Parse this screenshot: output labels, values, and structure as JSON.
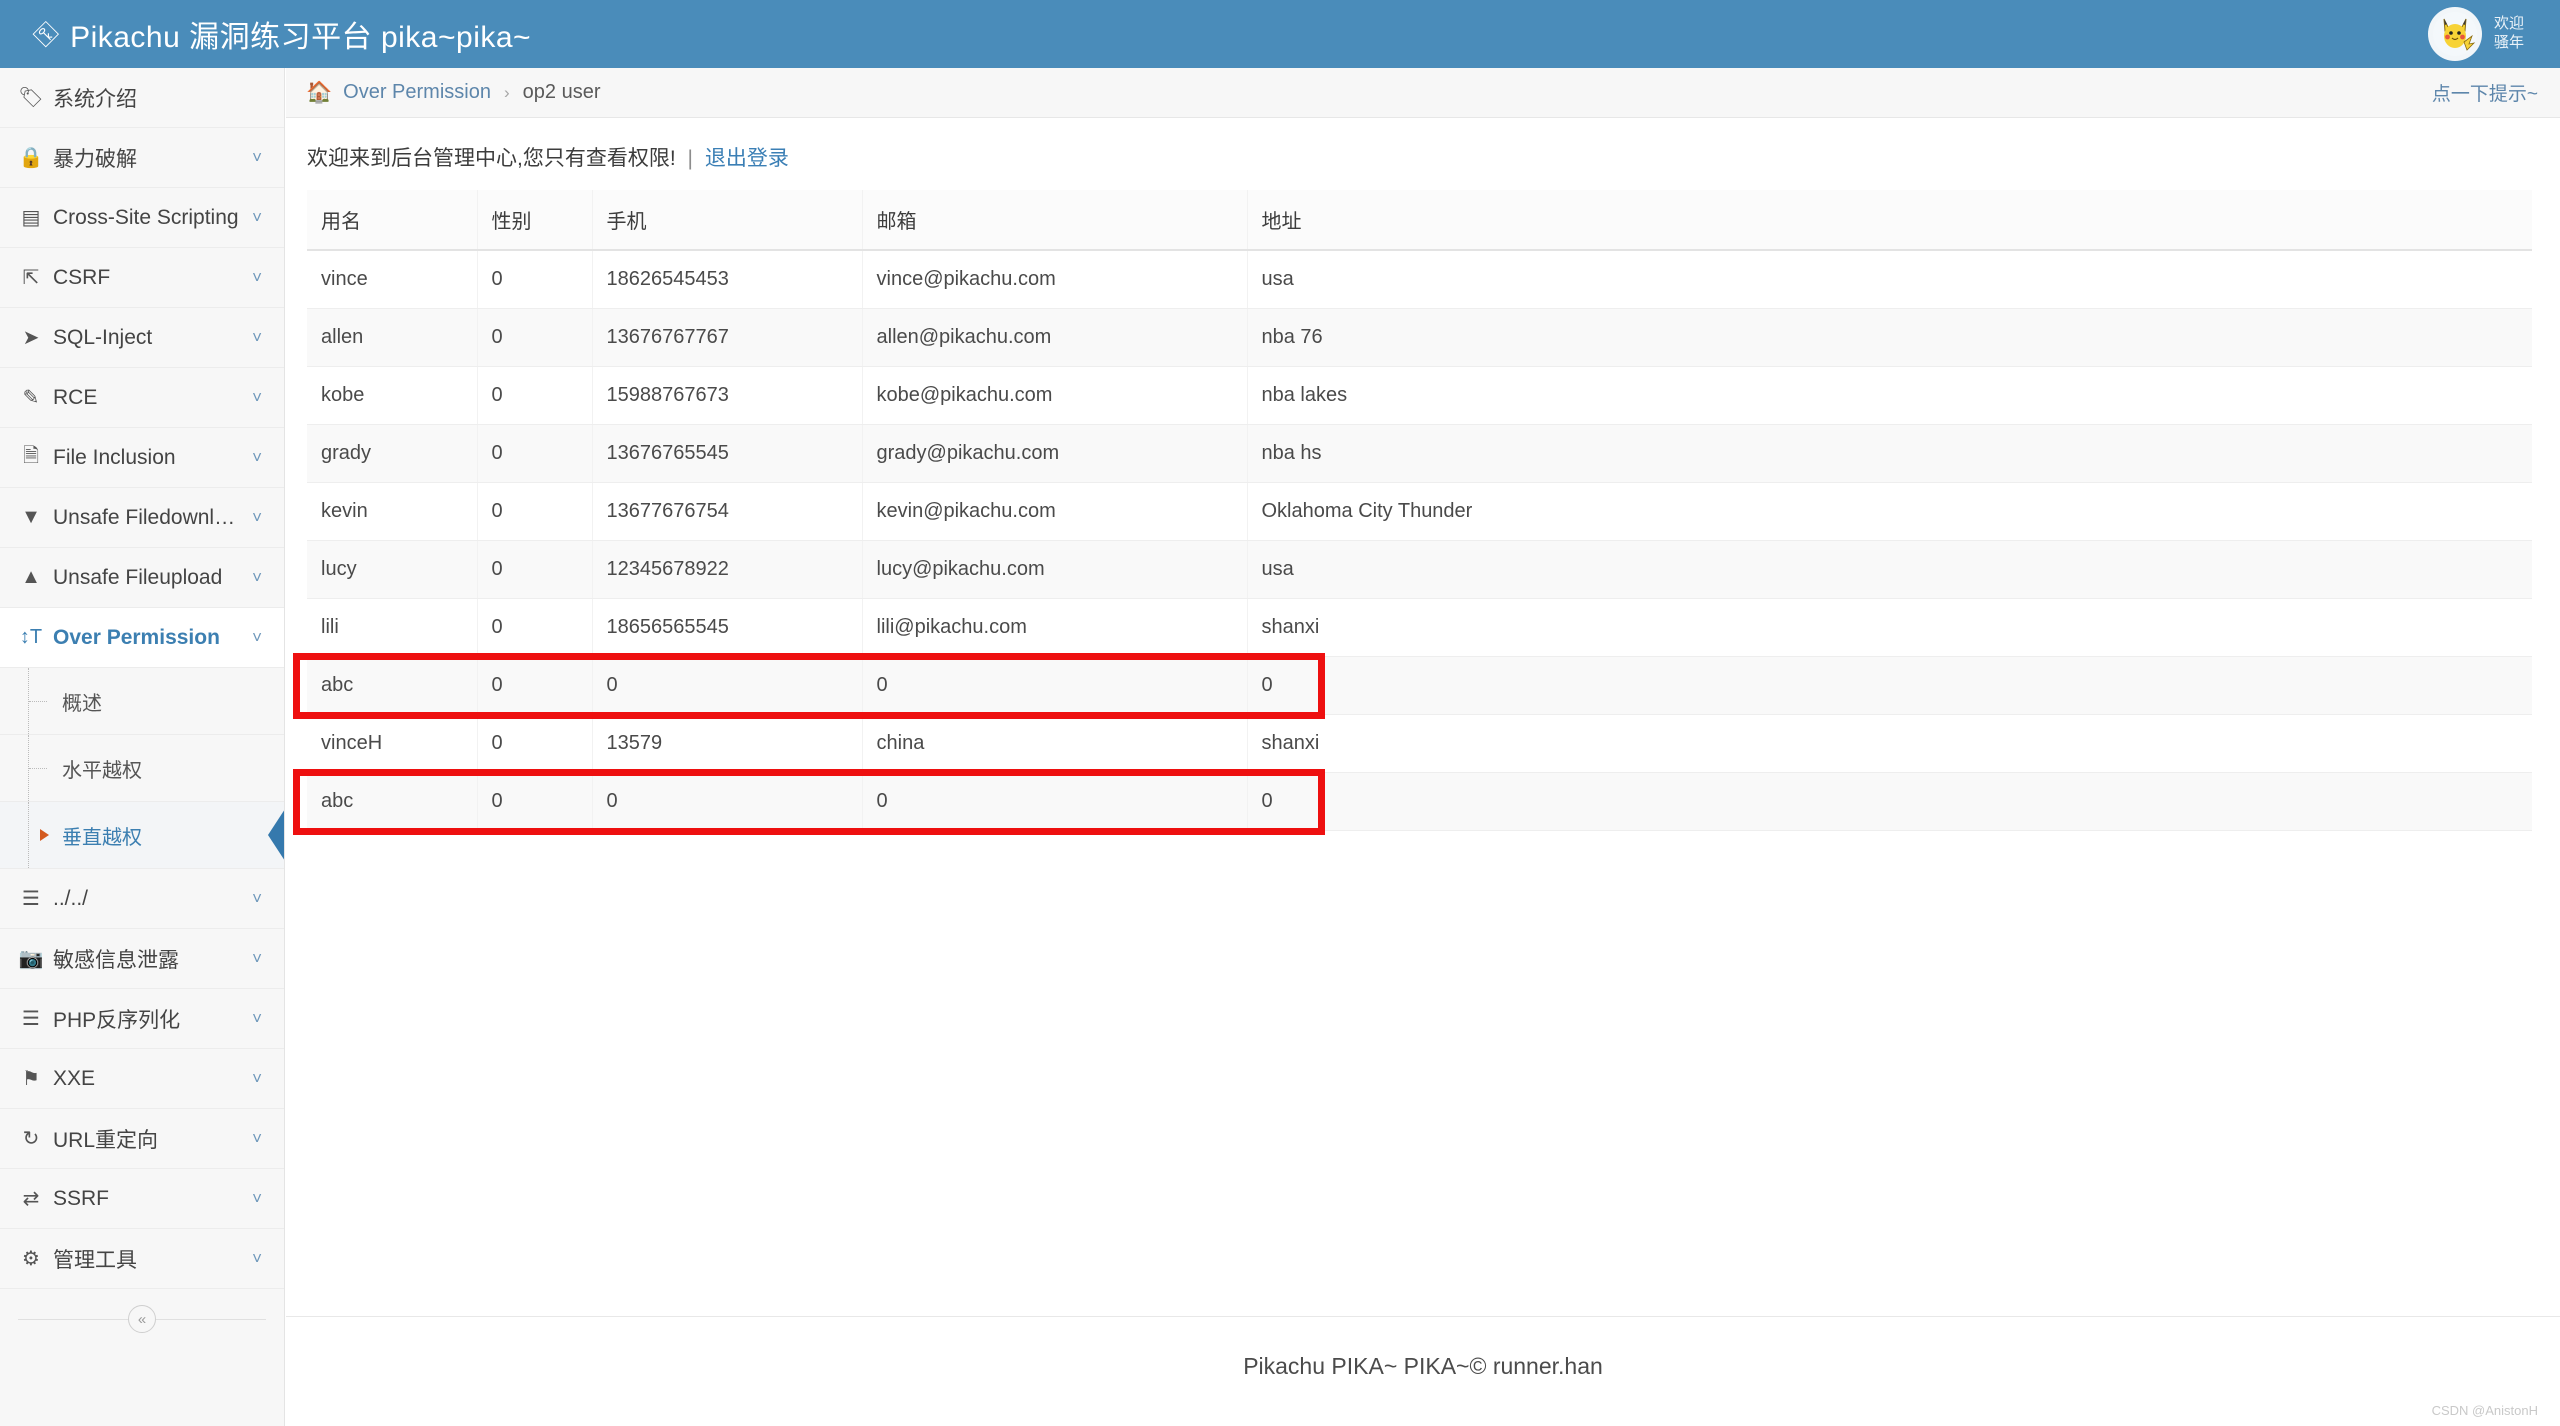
{
  "header": {
    "title": "Pikachu 漏洞练习平台 pika~pika~",
    "key_icon": "⚷",
    "welcome_line1": "欢迎",
    "welcome_line2": "骚年",
    "bg_color": "#4a8cba"
  },
  "sidebar": {
    "items": [
      {
        "label": "系统介绍",
        "icon": "tag-icon",
        "glyph": "🏷",
        "caret": false,
        "active": false
      },
      {
        "label": "暴力破解",
        "icon": "lock-icon",
        "glyph": "🔒",
        "caret": true,
        "active": false
      },
      {
        "label": "Cross-Site Scripting",
        "icon": "list-icon",
        "glyph": "☲",
        "caret": true,
        "active": false
      },
      {
        "label": "CSRF",
        "icon": "external-link-icon",
        "glyph": "↱",
        "caret": true,
        "active": false
      },
      {
        "label": "SQL-Inject",
        "icon": "plane-icon",
        "glyph": "✈",
        "caret": true,
        "active": false
      },
      {
        "label": "RCE",
        "icon": "pencil-icon",
        "glyph": "✎",
        "caret": true,
        "active": false
      },
      {
        "label": "File Inclusion",
        "icon": "file-icon",
        "glyph": "🗎",
        "caret": true,
        "active": false
      },
      {
        "label": "Unsafe Filedownload",
        "icon": "download-icon",
        "glyph": "⬇",
        "caret": true,
        "active": false
      },
      {
        "label": "Unsafe Fileupload",
        "icon": "upload-icon",
        "glyph": "⬆",
        "caret": true,
        "active": false
      },
      {
        "label": "Over Permission",
        "icon": "text-height-icon",
        "glyph": "T",
        "caret": true,
        "active": true
      }
    ],
    "sub_items": [
      {
        "label": "概述",
        "current": false
      },
      {
        "label": "水平越权",
        "current": false
      },
      {
        "label": "垂直越权",
        "current": true
      }
    ],
    "items_after": [
      {
        "label": "../../",
        "icon": "bars-icon",
        "glyph": "☰",
        "caret": true
      },
      {
        "label": "敏感信息泄露",
        "icon": "camera-icon",
        "glyph": "📷",
        "caret": true
      },
      {
        "label": "PHP反序列化",
        "icon": "bars-icon",
        "glyph": "☰",
        "caret": true
      },
      {
        "label": "XXE",
        "icon": "flag-icon",
        "glyph": "⚑",
        "caret": true
      },
      {
        "label": "URL重定向",
        "icon": "refresh-icon",
        "glyph": "↻",
        "caret": true
      },
      {
        "label": "SSRF",
        "icon": "exchange-icon",
        "glyph": "⇄",
        "caret": true
      },
      {
        "label": "管理工具",
        "icon": "gear-icon",
        "glyph": "⚙",
        "caret": true
      }
    ],
    "collapse_glyph": "«",
    "active_color": "#3c7fb1"
  },
  "breadcrumb": {
    "home_glyph": "🏠",
    "parent": "Over Permission",
    "separator": "›",
    "current": "op2 user",
    "hint_link": "点一下提示~"
  },
  "welcome_bar": {
    "message": "欢迎来到后台管理中心,您只有查看权限!",
    "pipe": "|",
    "logout": "退出登录"
  },
  "table": {
    "headers": [
      "用名",
      "性别",
      "手机",
      "邮箱",
      "地址"
    ],
    "rows": [
      {
        "user": "vince",
        "sex": "0",
        "phone": "18626545453",
        "mail": "vince@pikachu.com",
        "addr": "usa",
        "highlight": false
      },
      {
        "user": "allen",
        "sex": "0",
        "phone": "13676767767",
        "mail": "allen@pikachu.com",
        "addr": "nba 76",
        "highlight": false
      },
      {
        "user": "kobe",
        "sex": "0",
        "phone": "15988767673",
        "mail": "kobe@pikachu.com",
        "addr": "nba lakes",
        "highlight": false
      },
      {
        "user": "grady",
        "sex": "0",
        "phone": "13676765545",
        "mail": "grady@pikachu.com",
        "addr": "nba hs",
        "highlight": false
      },
      {
        "user": "kevin",
        "sex": "0",
        "phone": "13677676754",
        "mail": "kevin@pikachu.com",
        "addr": "Oklahoma City Thunder",
        "highlight": false
      },
      {
        "user": "lucy",
        "sex": "0",
        "phone": "12345678922",
        "mail": "lucy@pikachu.com",
        "addr": "usa",
        "highlight": false
      },
      {
        "user": "lili",
        "sex": "0",
        "phone": "18656565545",
        "mail": "lili@pikachu.com",
        "addr": "shanxi",
        "highlight": false
      },
      {
        "user": "abc",
        "sex": "0",
        "phone": "0",
        "mail": "0",
        "addr": "0",
        "highlight": true
      },
      {
        "user": "vinceH",
        "sex": "0",
        "phone": "13579",
        "mail": "china",
        "addr": "shanxi",
        "highlight": false
      },
      {
        "user": "abc",
        "sex": "0",
        "phone": "0",
        "mail": "0",
        "addr": "0",
        "highlight": true
      }
    ],
    "highlight_color": "#ee1010"
  },
  "footer": {
    "text": "Pikachu PIKA~ PIKA~© runner.han"
  },
  "watermark": {
    "text": "CSDN @AnistonH"
  }
}
